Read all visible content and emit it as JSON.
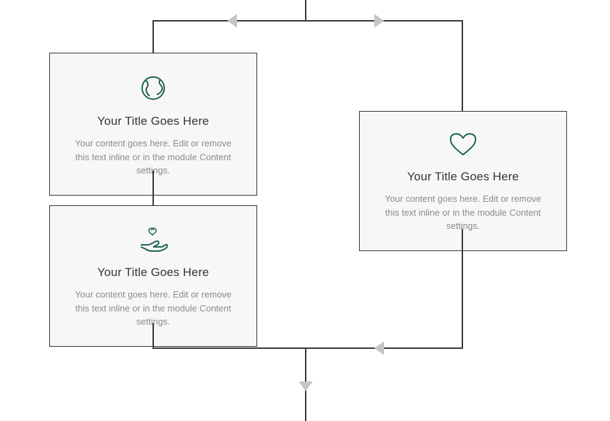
{
  "colors": {
    "accent": "#1d5e55",
    "border": "#333333",
    "arrow": "#c5c5c5",
    "card_bg": "#f7f7f7",
    "muted_text": "#8a8a8a"
  },
  "cards": {
    "globe": {
      "icon": "globe-icon",
      "title": "Your Title Goes Here",
      "content": "Your content goes here. Edit or remove this text inline or in the module Content settings."
    },
    "hand": {
      "icon": "hand-heart-icon",
      "title": "Your Title Goes Here",
      "content": "Your content goes here. Edit or remove this text inline or in the module Content settings."
    },
    "heart": {
      "icon": "heart-icon",
      "title": "Your Title Goes Here",
      "content": "Your content goes here. Edit or remove this text inline or in the module Content settings."
    }
  },
  "chart_data": {
    "type": "flowchart",
    "nodes": [
      {
        "id": "globe",
        "label": "Your Title Goes Here",
        "column": "left",
        "order": 1
      },
      {
        "id": "hand",
        "label": "Your Title Goes Here",
        "column": "left",
        "order": 2
      },
      {
        "id": "heart",
        "label": "Your Title Goes Here",
        "column": "right",
        "order": 1
      }
    ],
    "edges": [
      {
        "from": "top-center",
        "to": "globe",
        "direction": "left"
      },
      {
        "from": "top-center",
        "to": "heart",
        "direction": "right"
      },
      {
        "from": "globe",
        "to": "hand",
        "direction": "down"
      },
      {
        "from": "hand",
        "to": "bottom-center",
        "direction": "down-right"
      },
      {
        "from": "heart",
        "to": "bottom-center",
        "direction": "down-left"
      }
    ]
  }
}
